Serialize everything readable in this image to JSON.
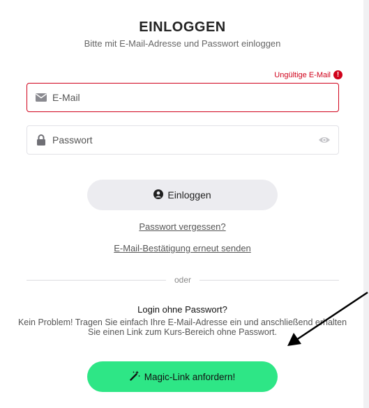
{
  "header": {
    "title": "EINLOGGEN",
    "subtitle": "Bitte mit E-Mail-Adresse und Passwort einloggen"
  },
  "email": {
    "error": "Ungültige E-Mail",
    "error_icon": "exclamation-circle-icon",
    "placeholder": "E-Mail",
    "value": "",
    "icon": "envelope-icon"
  },
  "password": {
    "placeholder": "Passwort",
    "value": "",
    "icon": "lock-icon",
    "toggle_icon": "eye-icon"
  },
  "actions": {
    "login_label": "Einloggen",
    "login_icon": "user-circle-icon",
    "forgot_password": "Passwort vergessen?",
    "resend_confirmation": "E-Mail-Bestätigung erneut senden"
  },
  "divider": {
    "label": "oder"
  },
  "passwordless": {
    "title": "Login ohne Passwort?",
    "description": "Kein Problem! Tragen Sie einfach Ihre E-Mail-Adresse ein und anschließend erhalten Sie einen Link zum Kurs-Bereich ohne Passwort.",
    "button_label": "Magic-Link anfordern!",
    "button_icon": "magic-wand-icon"
  },
  "colors": {
    "error": "#d0021b",
    "magic_button": "#2ee686",
    "login_button": "#ececf0"
  }
}
